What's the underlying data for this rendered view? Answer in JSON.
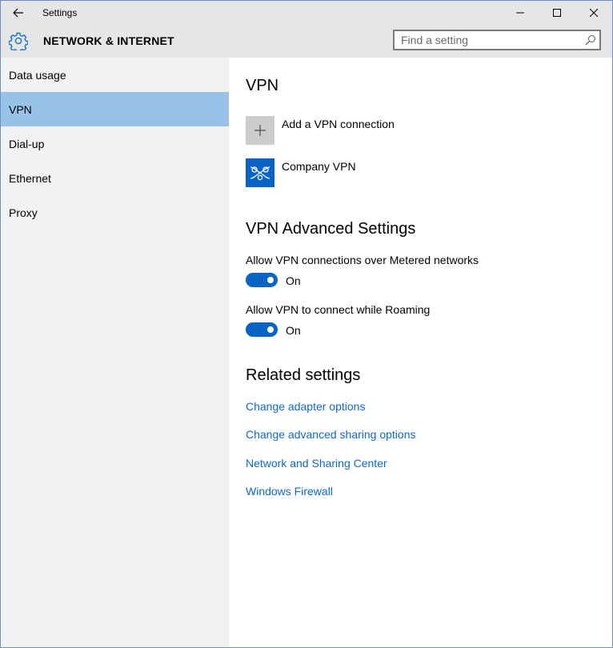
{
  "window": {
    "title": "Settings"
  },
  "header": {
    "section": "NETWORK & INTERNET",
    "search_placeholder": "Find a setting"
  },
  "sidebar": {
    "items": [
      {
        "label": "Data usage",
        "selected": false
      },
      {
        "label": "VPN",
        "selected": true
      },
      {
        "label": "Dial-up",
        "selected": false
      },
      {
        "label": "Ethernet",
        "selected": false
      },
      {
        "label": "Proxy",
        "selected": false
      }
    ]
  },
  "vpn": {
    "heading": "VPN",
    "add_label": "Add a VPN connection",
    "connections": [
      {
        "label": "Company VPN",
        "icon": "vpn-network-icon"
      }
    ]
  },
  "advanced": {
    "heading": "VPN Advanced Settings",
    "metered": {
      "label": "Allow VPN connections over Metered networks",
      "state": "On"
    },
    "roaming": {
      "label": "Allow VPN to connect while Roaming",
      "state": "On"
    }
  },
  "related": {
    "heading": "Related settings",
    "links": [
      "Change adapter options",
      "Change advanced sharing options",
      "Network and Sharing Center",
      "Windows Firewall"
    ]
  },
  "colors": {
    "accent": "#0a64c8",
    "selected_nav": "#99c2e8",
    "link": "#0b6acb",
    "chrome": "#e6e6e6",
    "sidebar": "#f2f2f2"
  }
}
